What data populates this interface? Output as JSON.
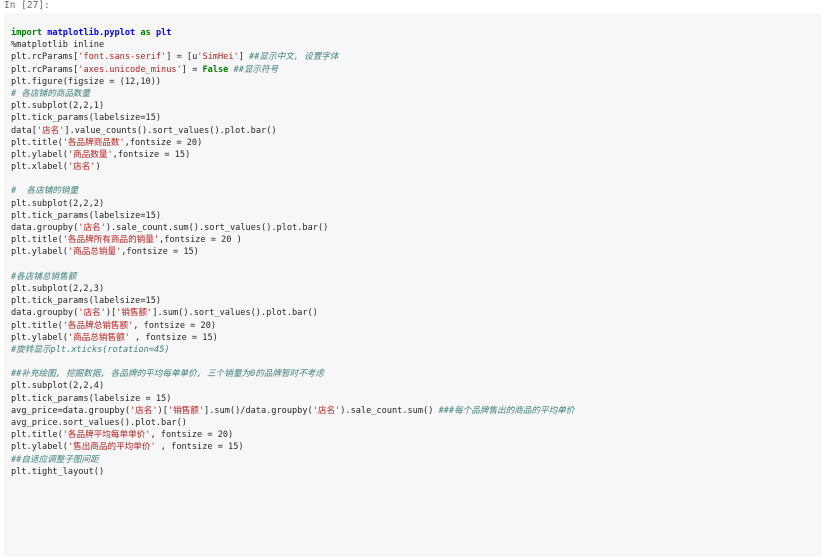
{
  "prompt": "In [27]:",
  "lines": [
    [
      [
        "kw",
        "import"
      ],
      [
        "t",
        " "
      ],
      [
        "mod",
        "matplotlib.pyplot"
      ],
      [
        "t",
        " "
      ],
      [
        "kw",
        "as"
      ],
      [
        "t",
        " "
      ],
      [
        "mod",
        "plt"
      ]
    ],
    [
      [
        "t",
        "%matplotlib inline"
      ]
    ],
    [
      [
        "t",
        "plt.rcParams["
      ],
      [
        "str",
        "'font.sans-serif'"
      ],
      [
        "t",
        "] = [u"
      ],
      [
        "str",
        "'SimHei'"
      ],
      [
        "t",
        "] "
      ],
      [
        "com",
        "##显示中文, 设置字体"
      ]
    ],
    [
      [
        "t",
        "plt.rcParams["
      ],
      [
        "str",
        "'axes.unicode_minus'"
      ],
      [
        "t",
        "] = "
      ],
      [
        "kw",
        "False"
      ],
      [
        "t",
        " "
      ],
      [
        "com",
        "##显示符号"
      ]
    ],
    [
      [
        "t",
        "plt.figure(figsize = (12,10))"
      ]
    ],
    [
      [
        "com",
        "# 各店铺的商品数量"
      ]
    ],
    [
      [
        "t",
        "plt.subplot(2,2,1)"
      ]
    ],
    [
      [
        "t",
        "plt.tick_params(labelsize=15)"
      ]
    ],
    [
      [
        "t",
        "data["
      ],
      [
        "str",
        "'店名'"
      ],
      [
        "t",
        "].value_counts().sort_values().plot.bar()"
      ]
    ],
    [
      [
        "t",
        "plt.title("
      ],
      [
        "str",
        "'各品牌商品数'"
      ],
      [
        "t",
        ",fontsize = 20)"
      ]
    ],
    [
      [
        "t",
        "plt.ylabel("
      ],
      [
        "str",
        "'商品数量'"
      ],
      [
        "t",
        ",fontsize = 15)"
      ]
    ],
    [
      [
        "t",
        "plt.xlabel("
      ],
      [
        "str",
        "'店名'"
      ],
      [
        "t",
        ")"
      ]
    ],
    [],
    [
      [
        "com",
        "#  各店铺的销量"
      ]
    ],
    [
      [
        "t",
        "plt.subplot(2,2,2)"
      ]
    ],
    [
      [
        "t",
        "plt.tick_params(labelsize=15)"
      ]
    ],
    [
      [
        "t",
        "data.groupby("
      ],
      [
        "str",
        "'店名'"
      ],
      [
        "t",
        ").sale_count.sum().sort_values().plot.bar()"
      ]
    ],
    [
      [
        "t",
        "plt.title("
      ],
      [
        "str",
        "'各品牌所有商品的销量'"
      ],
      [
        "t",
        ",fontsize = 20 )"
      ]
    ],
    [
      [
        "t",
        "plt.ylabel("
      ],
      [
        "str",
        "'商品总销量'"
      ],
      [
        "t",
        ",fontsize = 15)"
      ]
    ],
    [],
    [
      [
        "com",
        "#各店铺总销售额"
      ]
    ],
    [
      [
        "t",
        "plt.subplot(2,2,3)"
      ]
    ],
    [
      [
        "t",
        "plt.tick_params(labelsize=15)"
      ]
    ],
    [
      [
        "t",
        "data.groupby("
      ],
      [
        "str",
        "'店名'"
      ],
      [
        "t",
        ")["
      ],
      [
        "str",
        "'销售额'"
      ],
      [
        "t",
        "].sum().sort_values().plot.bar()"
      ]
    ],
    [
      [
        "t",
        "plt.title("
      ],
      [
        "str",
        "'各品牌总销售额'"
      ],
      [
        "t",
        ", fontsize = 20)"
      ]
    ],
    [
      [
        "t",
        "plt.ylabel("
      ],
      [
        "str",
        "'商品总销售额'"
      ],
      [
        "t",
        " , fontsize = 15)"
      ]
    ],
    [
      [
        "com",
        "#旋转显示plt.xticks(rotation=45)"
      ]
    ],
    [],
    [
      [
        "com",
        "##补充绘图, 挖掘数据, 各品牌的平均每单单价, 三个销量为0的品牌暂时不考虑"
      ]
    ],
    [
      [
        "t",
        "plt.subplot(2,2,4)"
      ]
    ],
    [
      [
        "t",
        "plt.tick_params(labelsize = 15)"
      ]
    ],
    [
      [
        "t",
        "avg_price=data.groupby("
      ],
      [
        "str",
        "'店名'"
      ],
      [
        "t",
        ")["
      ],
      [
        "str",
        "'销售额'"
      ],
      [
        "t",
        "].sum()/data.groupby("
      ],
      [
        "str",
        "'店名'"
      ],
      [
        "t",
        ").sale_count.sum() "
      ],
      [
        "com",
        "###每个品牌售出的商品的平均单价"
      ]
    ],
    [
      [
        "t",
        "avg_price.sort_values().plot.bar()"
      ]
    ],
    [
      [
        "t",
        "plt.title("
      ],
      [
        "str",
        "'各品牌平均每单单价'"
      ],
      [
        "t",
        ", fontsize = 20)"
      ]
    ],
    [
      [
        "t",
        "plt.ylabel("
      ],
      [
        "str",
        "'售出商品的平均单价'"
      ],
      [
        "t",
        " , fontsize = 15)"
      ]
    ],
    [
      [
        "com",
        "##自适应调整子图间距"
      ]
    ],
    [
      [
        "t",
        "plt.tight_layout()"
      ]
    ]
  ]
}
